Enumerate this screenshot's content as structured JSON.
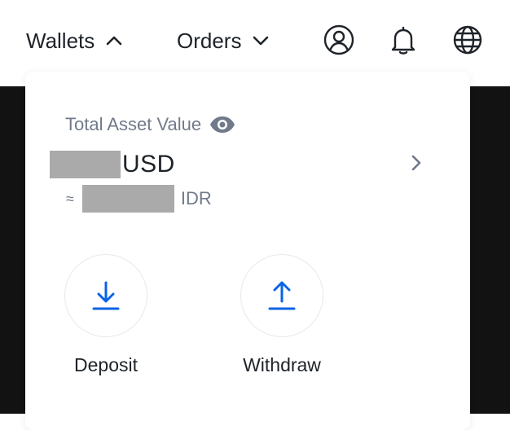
{
  "nav": {
    "wallets_label": "Wallets",
    "orders_label": "Orders",
    "icons": [
      "user-icon",
      "bell-icon",
      "globe-icon"
    ]
  },
  "wallet_panel": {
    "total_label": "Total Asset Value",
    "balance_currency": "USD",
    "approx_sign": "≈",
    "approx_currency": "IDR"
  },
  "actions": [
    {
      "label": "Deposit",
      "icon": "download-icon"
    },
    {
      "label": "Withdraw",
      "icon": "upload-icon"
    }
  ],
  "colors": {
    "accent": "#0b63e5",
    "text_primary": "#1e2329",
    "text_secondary": "#707a8a",
    "backdrop": "#121212"
  }
}
